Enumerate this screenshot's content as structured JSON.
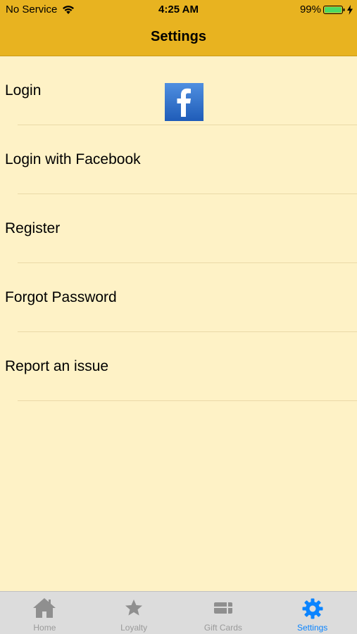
{
  "status_bar": {
    "carrier": "No Service",
    "time": "4:25 AM",
    "battery": "99%",
    "icons": [
      "wifi-icon",
      "battery-icon",
      "charging-bolt-icon"
    ]
  },
  "nav": {
    "title": "Settings"
  },
  "menu": {
    "items": [
      {
        "label": "Login"
      },
      {
        "label": "Login with Facebook",
        "icon": "facebook-icon"
      },
      {
        "label": "Register"
      },
      {
        "label": "Forgot Password"
      },
      {
        "label": "Report an issue"
      }
    ]
  },
  "tab_bar": {
    "tabs": [
      {
        "label": "Home",
        "icon": "home-icon"
      },
      {
        "label": "Loyalty",
        "icon": "star-icon"
      },
      {
        "label": "Gift Cards",
        "icon": "gift-card-icon"
      },
      {
        "label": "Settings",
        "icon": "gear-icon",
        "active": true
      }
    ],
    "active_color": "#0a84ff",
    "inactive_color": "#9a9a9a"
  },
  "colors": {
    "bar_background": "#e8b320",
    "page_background": "#fef2c6",
    "battery_fill": "#4cd964",
    "facebook_blue": "#2a6fc9"
  }
}
